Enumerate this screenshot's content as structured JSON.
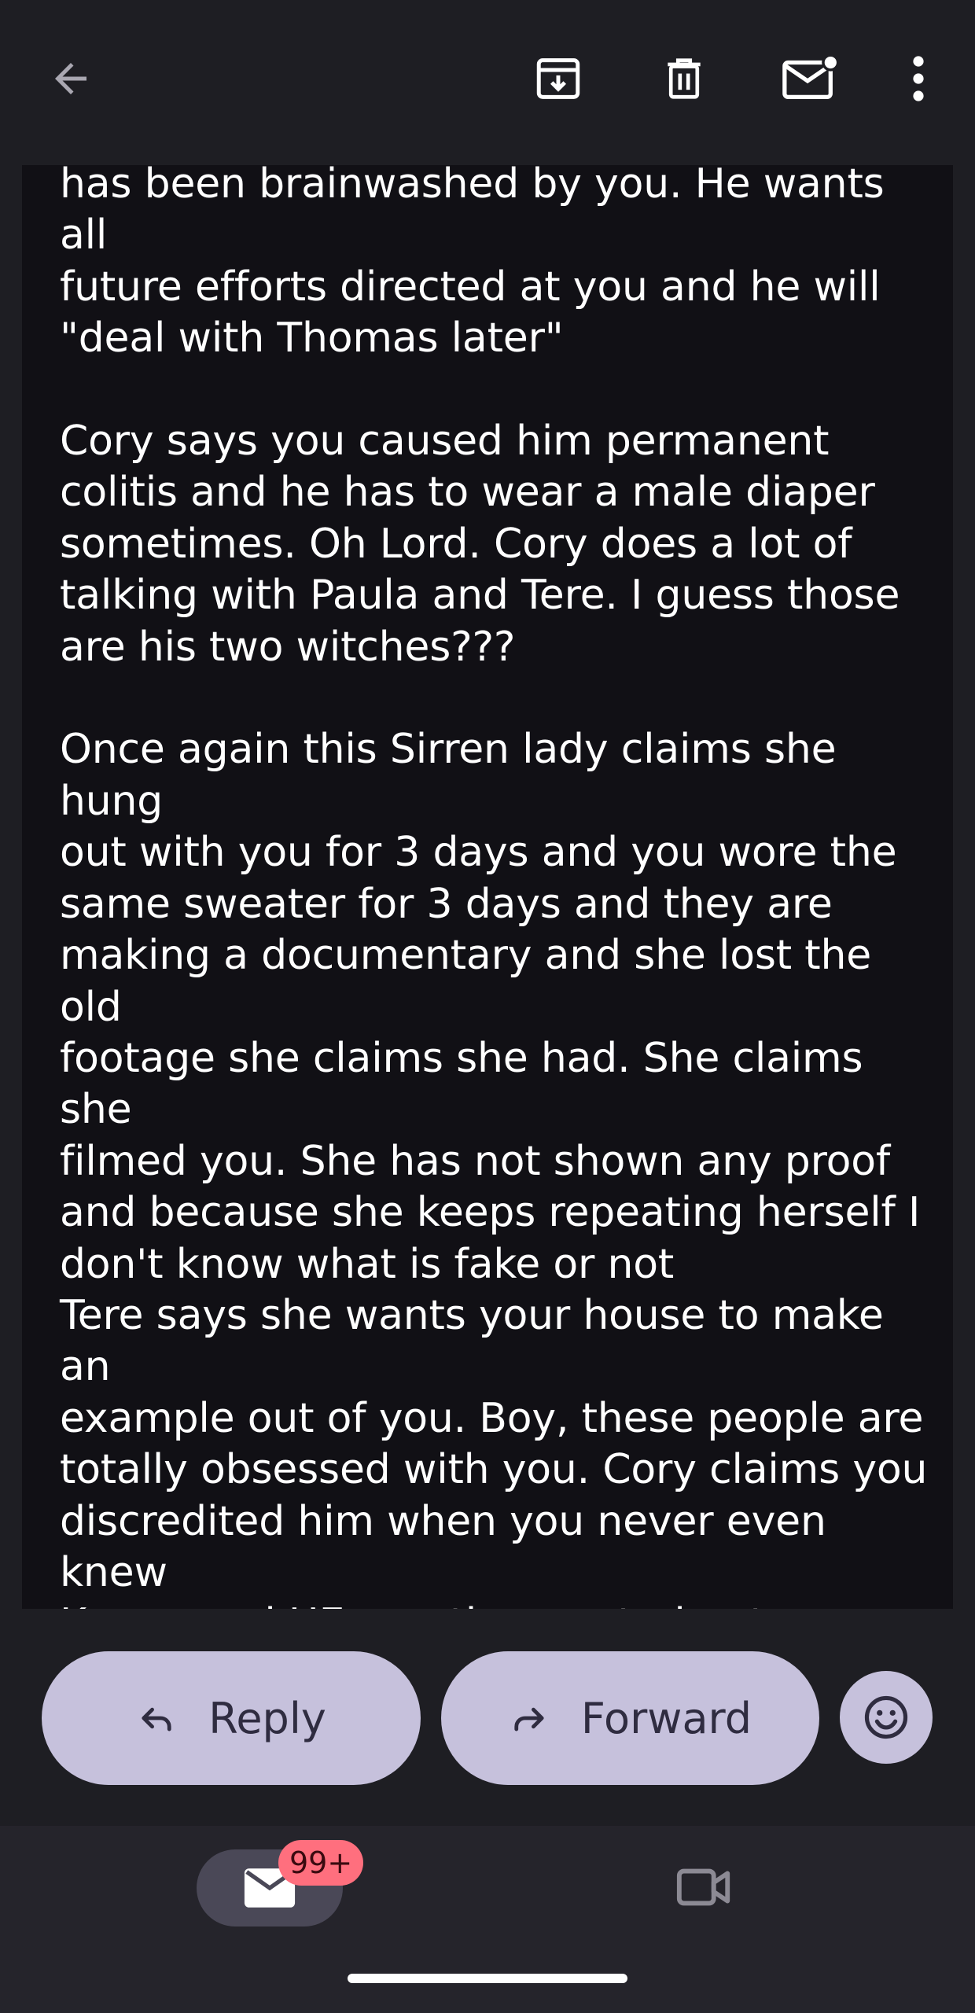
{
  "toolbar": {
    "back_icon": "arrow-left-icon",
    "archive_icon": "archive-icon",
    "delete_icon": "trash-icon",
    "mark_unread_icon": "mail-unread-icon",
    "more_icon": "more-vert-icon"
  },
  "message": {
    "body": "has been brainwashed by you. He wants all\nfuture efforts directed at you and he will\n\"deal with Thomas later\"\n\nCory says you caused him permanent\ncolitis and he has to wear a male diaper\nsometimes. Oh Lord. Cory does a lot of\ntalking with Paula and Tere. I guess those\nare his two witches???\n\nOnce again this Sirren lady claims she hung\nout with you for 3 days and you wore the\nsame sweater for 3 days and they are\nmaking a documentary and she lost the old\nfootage she claims she had. She claims she\nfilmed you. She has not shown any proof\nand because she keeps repeating herself I\ndon't know what is fake or not\nTere says she wants your house to make an\nexample out of you. Boy, these people are\ntotally obsessed with you. Cory claims you\ndiscredited him when you never even knew\nKappy and HE was the one trying to rescue\nKappy\n\nThese are a bunch of satanic pedophile\nswingers and all are all deranged\nAll I can say is Wow!"
  },
  "actions": {
    "reply_label": "Reply",
    "forward_label": "Forward",
    "reply_icon": "reply-icon",
    "forward_icon": "forward-icon",
    "emoji_icon": "smiley-icon"
  },
  "bottom_nav": {
    "mail_icon": "mail-icon",
    "mail_badge": "99+",
    "meet_icon": "video-camera-icon"
  },
  "colors": {
    "background": "#1e1e23",
    "content_bg": "#111015",
    "pill": "#c6c1dc",
    "badge": "#ff6f7e"
  }
}
